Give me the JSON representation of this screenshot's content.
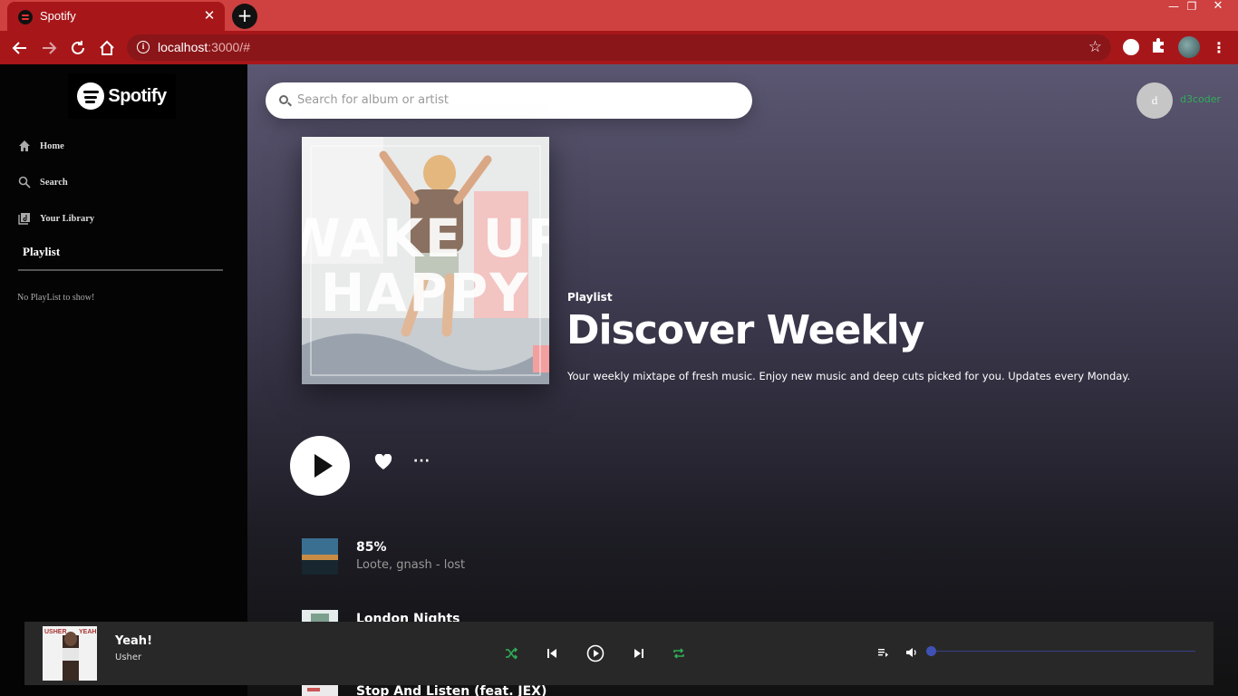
{
  "browser": {
    "tab_title": "Spotify",
    "url_host": "localhost",
    "url_path": ":3000/#",
    "new_tab_label": "+",
    "close_tab_label": "✕"
  },
  "sidebar": {
    "logo_text": "Spotify",
    "nav": [
      {
        "label": "Home",
        "icon": "home-icon"
      },
      {
        "label": "Search",
        "icon": "search-icon"
      },
      {
        "label": "Your Library",
        "icon": "library-icon"
      }
    ],
    "playlist_heading": "Playlist",
    "empty_text": "No PlayList to show!"
  },
  "header": {
    "search_placeholder": "Search for album or artist",
    "avatar_initial": "d",
    "username": "d3coder"
  },
  "playlist": {
    "cover_text_line1": "WAKE UP",
    "cover_text_line2": "HAPPY",
    "label": "Playlist",
    "title": "Discover Weekly",
    "description": "Your weekly mixtape of fresh music. Enjoy new music and deep cuts picked for you. Updates every Monday.",
    "more_label": "···"
  },
  "tracks": [
    {
      "name": "85%",
      "artist": "Loote, gnash - lost"
    },
    {
      "name": "London Nights",
      "artist": ""
    },
    {
      "name": "Stop And Listen (feat. JEX)",
      "artist": ""
    }
  ],
  "player": {
    "title": "Yeah!",
    "artist": "Usher",
    "art_text_left": "USHER",
    "art_text_right": "YEAH",
    "volume": 0,
    "accent_color": "#2fae57",
    "slider_color": "#3f51b5"
  }
}
